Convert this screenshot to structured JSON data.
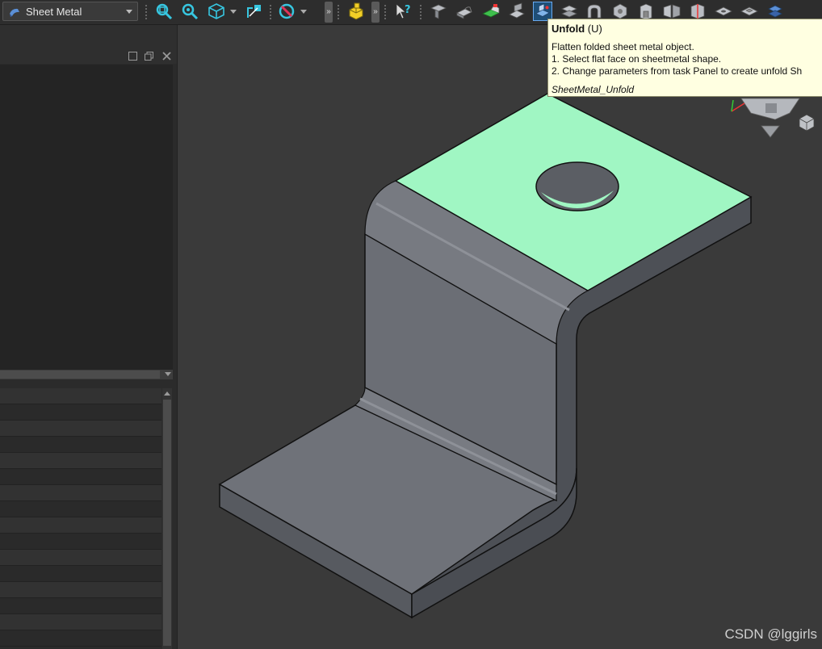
{
  "workbench": {
    "label": "Sheet Metal",
    "icon": "sheet-metal-workbench-icon"
  },
  "toolbar": {
    "icons": [
      "fit-all-icon",
      "fit-selection-icon",
      "standard-views-icon",
      "measure-icon",
      "draw-style-icon",
      "part-design-icon",
      "whats-this-icon",
      "make-wall-icon",
      "extrude-icon",
      "fold-icon",
      "relief-icon",
      "unfold-icon",
      "corner-relief-icon",
      "make-bend-icon",
      "sketch-on-sheetmetal-icon",
      "base-shape-icon",
      "junction-icon",
      "split-icon",
      "rip-icon",
      "form-icon",
      "formed-tool-icon",
      "sheet-metal-stamp-icon"
    ],
    "overflow_label": "»"
  },
  "tooltip": {
    "title": "Unfold",
    "shortcut": "(U)",
    "line1": "Flatten folded sheet metal object.",
    "line2": "1. Select flat face on sheetmetal shape.",
    "line3": "2. Change parameters from task Panel to create unfold Sh",
    "command": "SheetMetal_Unfold"
  },
  "watermark": "CSDN @lggirls",
  "colors": {
    "selected_face": "#a0f6c3",
    "part_gray": "#6e7178",
    "viewport_bg": "#3a3a3a",
    "tooltip_bg": "#ffffe1"
  }
}
